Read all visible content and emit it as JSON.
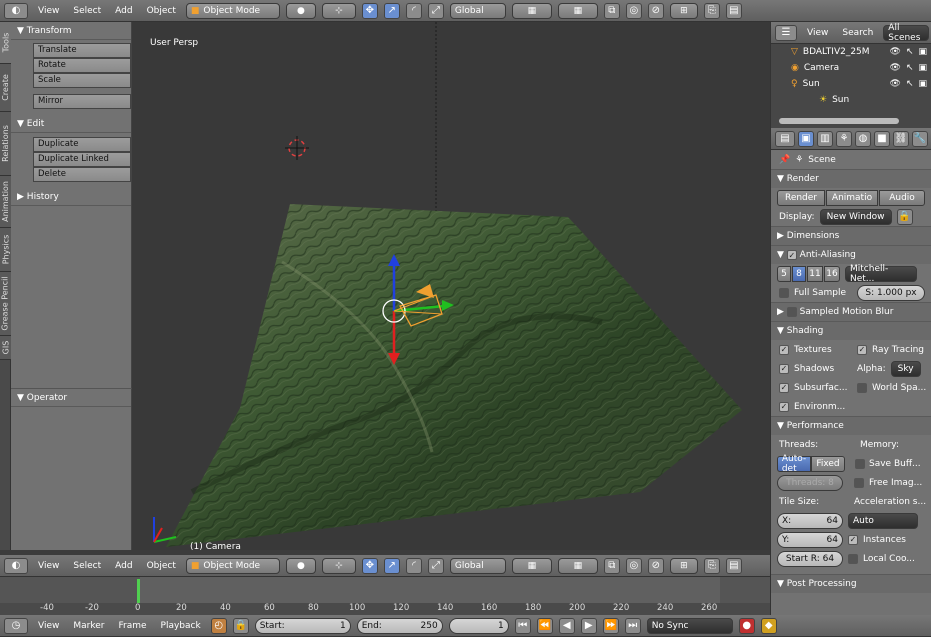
{
  "top_header": {
    "menus": [
      "View",
      "Select",
      "Add",
      "Object"
    ],
    "mode": "Object Mode",
    "orientation": "Global"
  },
  "tabs": [
    "Tools",
    "Create",
    "Relations",
    "Animation",
    "Physics",
    "Grease Pencil",
    "GIS"
  ],
  "toolshelf": {
    "transform_title": "Transform",
    "transform_buttons": [
      "Translate",
      "Rotate",
      "Scale"
    ],
    "mirror": "Mirror",
    "edit_title": "Edit",
    "edit_buttons": [
      "Duplicate",
      "Duplicate Linked",
      "Delete"
    ],
    "history_title": "History",
    "operator_title": "Operator"
  },
  "viewport": {
    "label": "User Persp",
    "object_label": "(1) Camera"
  },
  "outliner": {
    "menus": [
      "View",
      "Search"
    ],
    "scene_button": "All Scenes",
    "items": [
      "BDALTIV2_25M",
      "Camera",
      "Sun"
    ],
    "sub_item": "Sun"
  },
  "properties": {
    "scene": "Scene",
    "render_title": "Render",
    "render_buttons": [
      "Render",
      "Animatio",
      "Audio"
    ],
    "display_label": "Display:",
    "display_value": "New Window",
    "dimensions": "Dimensions",
    "anti_aliasing": "Anti-Aliasing",
    "aa_samples": [
      "5",
      "8",
      "11",
      "16"
    ],
    "aa_filter": "Mitchell-Net...",
    "full_sample": "Full Sample",
    "filter_size": "S: 1.000 px",
    "motion_blur": "Sampled Motion Blur",
    "shading_title": "Shading",
    "textures": "Textures",
    "ray_tracing": "Ray Tracing",
    "shadows": "Shadows",
    "alpha_label": "Alpha:",
    "alpha_value": "Sky",
    "subsurface": "Subsurfac...",
    "world_space": "World Spa...",
    "environment": "Environm...",
    "performance_title": "Performance",
    "threads_label": "Threads:",
    "memory_label": "Memory:",
    "threads_auto": "Auto-det",
    "threads_fixed": "Fixed",
    "save_buffers": "Save Buff...",
    "threads_count": "Threads: 8",
    "free_image": "Free Imag...",
    "tile_size": "Tile Size:",
    "acceleration": "Acceleration s...",
    "tile_x": "X:",
    "tile_x_val": "64",
    "accel_value": "Auto",
    "tile_y": "Y:",
    "tile_y_val": "64",
    "instances": "Instances",
    "start_r": "Start R: 64",
    "local_coords": "Local Coo...",
    "post_processing": "Post Processing"
  },
  "timeline": {
    "menus": [
      "View",
      "Select",
      "Add",
      "Object"
    ],
    "mode": "Object Mode",
    "orientation": "Global",
    "ruler": [
      "-40",
      "-20",
      "0",
      "20",
      "40",
      "60",
      "80",
      "100",
      "120",
      "140",
      "160",
      "180",
      "200",
      "220",
      "240",
      "260"
    ]
  },
  "footer": {
    "menus": [
      "View",
      "Marker",
      "Frame",
      "Playback"
    ],
    "start_label": "Start:",
    "start_value": "1",
    "end_label": "End:",
    "end_value": "250",
    "current": "1",
    "sync": "No Sync"
  }
}
